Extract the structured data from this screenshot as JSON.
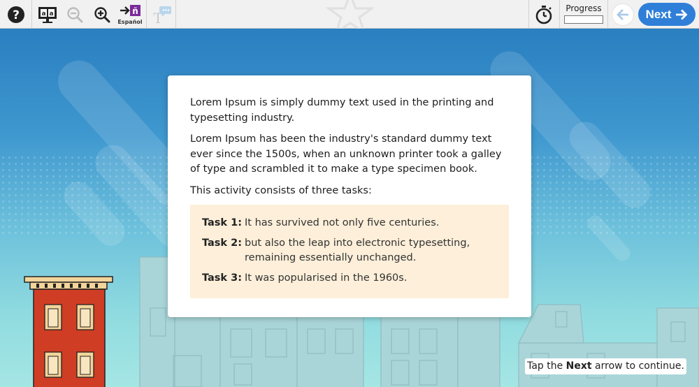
{
  "toolbar": {
    "help_icon": "question-circle-icon",
    "glossary_icon": "glossary-screen-icon",
    "glossary_glyph": "a|a",
    "zoom_out_icon": "zoom-out-icon",
    "zoom_in_icon": "zoom-in-icon",
    "spanish_icon": "arrow-enye-icon",
    "spanish_glyph": "ñ",
    "spanish_label": "Español",
    "text_to_speech_icon": "text-speech-bubble-icon",
    "timer_icon": "stopwatch-icon",
    "progress_label": "Progress",
    "progress_value": 0,
    "back_icon": "arrow-left-icon",
    "next_label": "Next",
    "next_icon": "arrow-right-icon"
  },
  "dialog": {
    "paragraphs": [
      "Lorem Ipsum is simply dummy text used in the printing and typesetting industry.",
      "Lorem Ipsum has been the industry's standard dummy text ever since the 1500s, when an unknown printer took a galley of type and scrambled it to make a type specimen book.",
      "This activity consists of three tasks:"
    ],
    "tasks": [
      {
        "label": "Task 1:",
        "text": "It has survived not only five centuries."
      },
      {
        "label": "Task 2:",
        "text": "but also the leap into electronic typesetting, remaining essentially unchanged."
      },
      {
        "label": "Task 3:",
        "text": "It was popularised in the 1960s."
      }
    ]
  },
  "hint": {
    "before": "Tap the ",
    "bold": "Next",
    "after": " arrow to continue."
  },
  "colors": {
    "accent": "#2f7fd8",
    "toolbar_bg": "#f1f1f1",
    "task_bg": "#fdefd9",
    "spanish_purple": "#7a2a9a"
  }
}
